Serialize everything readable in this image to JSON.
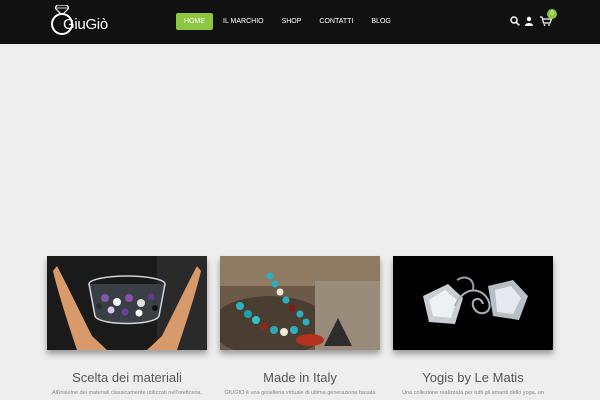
{
  "header": {
    "logo_text": "GiuGiò",
    "nav": [
      {
        "label": "HOME",
        "active": true
      },
      {
        "label": "IL MARCHIO",
        "active": false
      },
      {
        "label": "SHOP",
        "active": false
      },
      {
        "label": "CONTATTI",
        "active": false
      },
      {
        "label": "BLOG",
        "active": false
      }
    ],
    "icons": [
      "search-icon",
      "user-icon",
      "cart-icon"
    ],
    "cart_count": "0"
  },
  "colors": {
    "header_bg": "#111111",
    "accent": "#8dc63f",
    "page_bg": "#eeeeee"
  },
  "cards": [
    {
      "title": "Scelta dei materiali",
      "text": "All'insieme dei materiali classicamente utilizzati nell'oreficeria,"
    },
    {
      "title": "Made in Italy",
      "text": "GIUGIÒ è una gioielleria virtuale di ultima generazione basata"
    },
    {
      "title": "Yogis by Le Matis",
      "text": "Una collezione realizzata per tutti gli amanti dello yoga, un"
    }
  ]
}
